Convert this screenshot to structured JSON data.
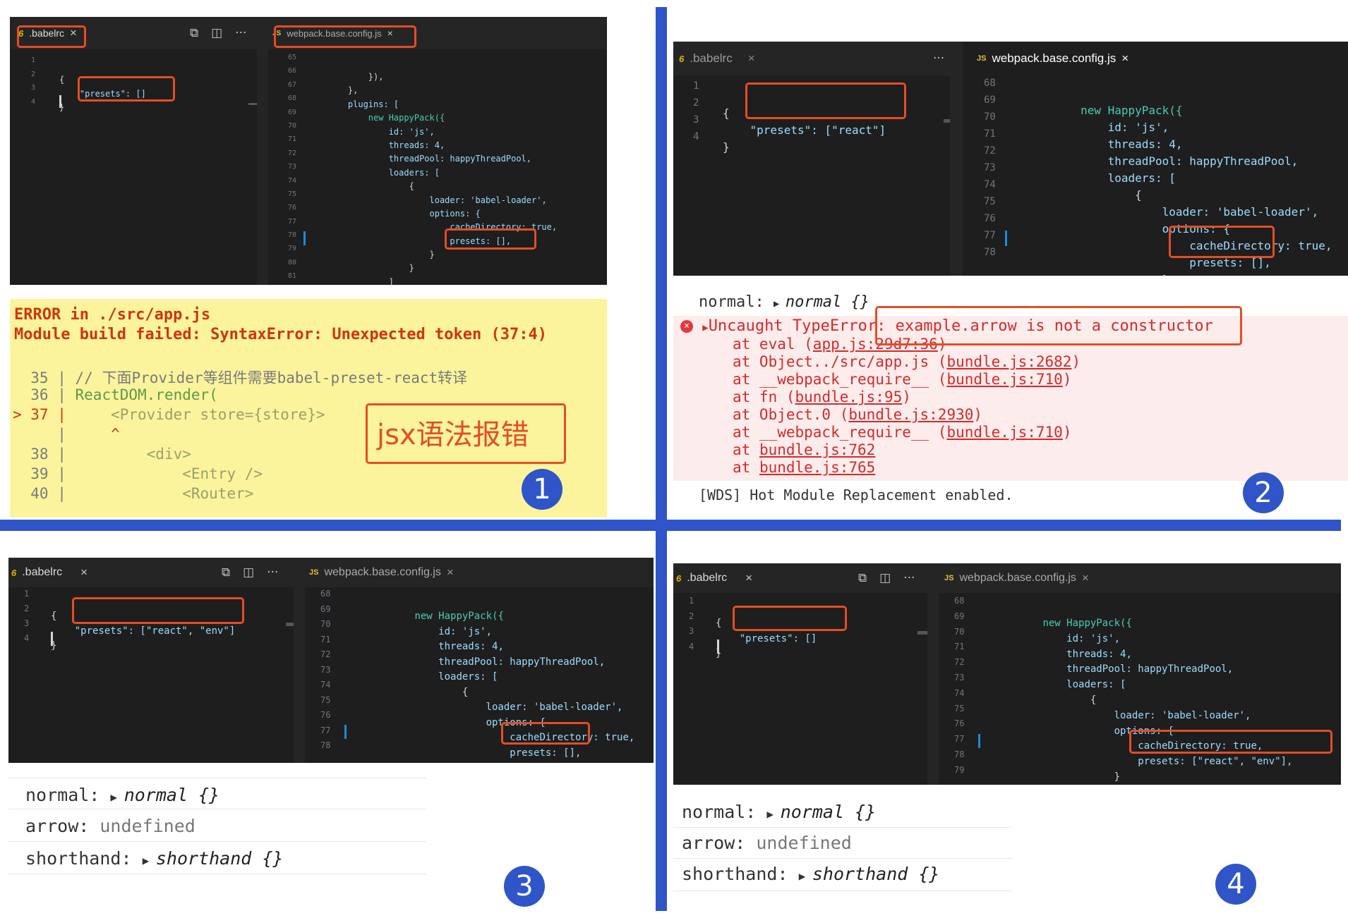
{
  "colors": {
    "divider": "#2f55c8",
    "highlight": "#e44d26",
    "editor_bg": "#1e1e1e",
    "error_panel": "#fcf49c",
    "error_text": "#d0350d"
  },
  "icons": [
    "babel-config-icon",
    "js-file-icon",
    "close-icon",
    "open-changes-icon",
    "split-editor-icon",
    "more-actions-icon",
    "error-circle-icon",
    "expand-triangle-icon"
  ],
  "tabs": {
    "babelrc": ".babelrc",
    "webpack": "webpack.base.config.js",
    "babel_type": "6",
    "js_type": "JS",
    "close": "×",
    "more": "···"
  },
  "webpack_code": {
    "happypack": "new HappyPack({",
    "id": "id: 'js',",
    "threads": "threads: 4,",
    "threadpool": "threadPool: happyThreadPool,",
    "loaders": "loaders: [",
    "open_brace": "{",
    "loader": "loader: 'babel-loader',",
    "options": "options: {",
    "cache": "cacheDirectory: true,",
    "close_brace": "}",
    "close_bracket": "]",
    "close_call": "}),",
    "close_obj": "}),",
    "close_arr": "},",
    "plugins": "plugins: ["
  },
  "q1": {
    "babel_lines": [
      "1",
      "2",
      "3",
      "4"
    ],
    "babel_presets": "\"presets\": []",
    "webpack_lines": [
      "65",
      "66",
      "67",
      "68",
      "69",
      "70",
      "71",
      "72",
      "73",
      "74",
      "75",
      "76",
      "77",
      "78",
      "79",
      "80",
      "81"
    ],
    "webpack_presets": "presets: [],",
    "error_title": "ERROR in ./src/app.js",
    "error_msg": "Module build failed: SyntaxError: Unexpected token (37:4)",
    "src": [
      {
        "prefix": "  35 | ",
        "text": "// 下面Provider等组件需要babel-preset-react转译"
      },
      {
        "prefix": "  36 | ",
        "text": "ReactDOM.render("
      },
      {
        "prefix": "> 37 | ",
        "text": "    <Provider store={store}>"
      },
      {
        "prefix": "     | ",
        "text": "    ^"
      },
      {
        "prefix": "  38 | ",
        "text": "        <div>"
      },
      {
        "prefix": "  39 | ",
        "text": "            <Entry />"
      },
      {
        "prefix": "  40 | ",
        "text": "            <Router>"
      }
    ],
    "annotation": "jsx语法报错",
    "badge": "1"
  },
  "q2": {
    "babel_lines": [
      "1",
      "2",
      "3",
      "4"
    ],
    "babel_presets": "\"presets\": [\"react\"]",
    "webpack_lines": [
      "68",
      "69",
      "70",
      "71",
      "72",
      "73",
      "74",
      "75",
      "76",
      "77",
      "78"
    ],
    "webpack_presets": "presets: [],",
    "normal_label": "normal: ",
    "normal_value": "normal {}",
    "error_head": "Uncaught TypeError: example.arrow is not a constructor",
    "stack": [
      {
        "pre": "at eval (",
        "link": "app.js:29d7:36",
        "post": ")"
      },
      {
        "pre": "at Object../src/app.js (",
        "link": "bundle.js:2682",
        "post": ")"
      },
      {
        "pre": "at __webpack_require__ (",
        "link": "bundle.js:710",
        "post": ")"
      },
      {
        "pre": "at fn (",
        "link": "bundle.js:95",
        "post": ")"
      },
      {
        "pre": "at Object.0 (",
        "link": "bundle.js:2930",
        "post": ")"
      },
      {
        "pre": "at __webpack_require__ (",
        "link": "bundle.js:710",
        "post": ")"
      },
      {
        "pre": "at ",
        "link": "bundle.js:762",
        "post": ""
      },
      {
        "pre": "at ",
        "link": "bundle.js:765",
        "post": ""
      }
    ],
    "wds": "[WDS] Hot Module Replacement enabled.",
    "badge": "2"
  },
  "q3": {
    "babel_lines": [
      "1",
      "2",
      "3",
      "4"
    ],
    "babel_presets": "\"presets\": [\"react\", \"env\"]",
    "webpack_lines": [
      "68",
      "69",
      "70",
      "71",
      "72",
      "73",
      "74",
      "75",
      "76",
      "77",
      "78"
    ],
    "webpack_presets": "presets: [],",
    "console": [
      {
        "label": "normal: ",
        "value": "normal {}",
        "kind": "obj"
      },
      {
        "label": "arrow: ",
        "value": "undefined",
        "kind": "undef"
      },
      {
        "label": "shorthand: ",
        "value": "shorthand {}",
        "kind": "obj"
      }
    ],
    "badge": "3"
  },
  "q4": {
    "babel_lines": [
      "1",
      "2",
      "3",
      "4"
    ],
    "babel_presets": "\"presets\": []",
    "webpack_lines": [
      "68",
      "69",
      "70",
      "71",
      "72",
      "73",
      "74",
      "75",
      "76",
      "77",
      "78",
      "79"
    ],
    "webpack_presets": "presets: [\"react\", \"env\"],",
    "console": [
      {
        "label": "normal: ",
        "value": "normal {}",
        "kind": "obj"
      },
      {
        "label": "arrow: ",
        "value": "undefined",
        "kind": "undef"
      },
      {
        "label": "shorthand: ",
        "value": "shorthand {}",
        "kind": "obj"
      }
    ],
    "badge": "4"
  }
}
